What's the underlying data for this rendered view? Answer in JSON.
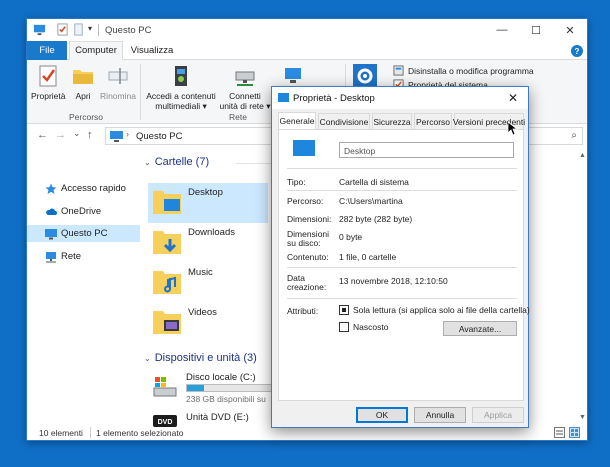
{
  "explorer": {
    "title": "Questo PC",
    "window_controls": {
      "minimize": "—",
      "maximize": "☐",
      "close": "✕"
    },
    "quick_access_arrow": "▾",
    "tabs": {
      "file": "File",
      "computer": "Computer",
      "view": "Visualizza",
      "help": "?"
    },
    "ribbon": {
      "properties": "Proprietà",
      "open": "Apri",
      "rename": "Rinomina",
      "group_location": "Percorso",
      "access_media_line1": "Accedi a contenuti",
      "access_media_line2": "multimediali ▾",
      "map_drive_line1": "Connetti",
      "map_drive_line2": "unità di rete ▾",
      "group_network": "Rete",
      "uninstall": "Disinstalla o modifica programma",
      "system_props": "Proprietà del sistema"
    },
    "address": {
      "back": "←",
      "forward": "→",
      "dropdown": "⌄",
      "up": "↑",
      "separator": "›",
      "path": "Questo PC",
      "search_icon": "⌕"
    },
    "sidebar": [
      {
        "label": "Accesso rapido",
        "icon": "star-icon"
      },
      {
        "label": "OneDrive",
        "icon": "cloud-icon"
      },
      {
        "label": "Questo PC",
        "icon": "computer-icon"
      },
      {
        "label": "Rete",
        "icon": "network-icon"
      }
    ],
    "folders_header": "Cartelle (7)",
    "folders": [
      "Desktop",
      "Downloads",
      "Music",
      "Videos"
    ],
    "devices_header": "Dispositivi e unità (3)",
    "drives": [
      {
        "name": "Disco locale (C:)",
        "free": "238 GB disponibili su",
        "used_fraction": 0.15
      },
      {
        "name": "Unità DVD (E:)"
      }
    ],
    "status": {
      "items": "10 elementi",
      "selected": "1 elemento selezionato"
    },
    "chevron": "⌄",
    "scroll_up": "▲",
    "scroll_down": "▼"
  },
  "dialog": {
    "title": "Proprietà - Desktop",
    "close": "✕",
    "tabs": [
      "Generale",
      "Condivisione",
      "Sicurezza",
      "Percorso",
      "Versioni precedenti"
    ],
    "name_value": "Desktop",
    "type_label": "Tipo:",
    "type_value": "Cartella di sistema",
    "path_label": "Percorso:",
    "path_value": "C:\\Users\\martina",
    "size_label": "Dimensioni:",
    "size_value": "282 byte (282 byte)",
    "disk_size_label_1": "Dimensioni",
    "disk_size_label_2": "su disco:",
    "disk_size_value": "0 byte",
    "contents_label": "Contenuto:",
    "contents_value": "1 file, 0 cartelle",
    "created_label_1": "Data",
    "created_label_2": "creazione:",
    "created_value": "13 novembre 2018, 12:10:50",
    "attributes_label": "Attributi:",
    "readonly_label": "Sola lettura (si applica solo ai file della cartella)",
    "hidden_label": "Nascosto",
    "advanced_button": "Avanzate...",
    "ok_button": "OK",
    "cancel_button": "Annulla",
    "apply_button": "Applica"
  },
  "colors": {
    "desktop_bg": "#0f6fc6",
    "accent": "#1979ca",
    "selection": "#cce8ff",
    "folder": "#f7cf5b"
  }
}
